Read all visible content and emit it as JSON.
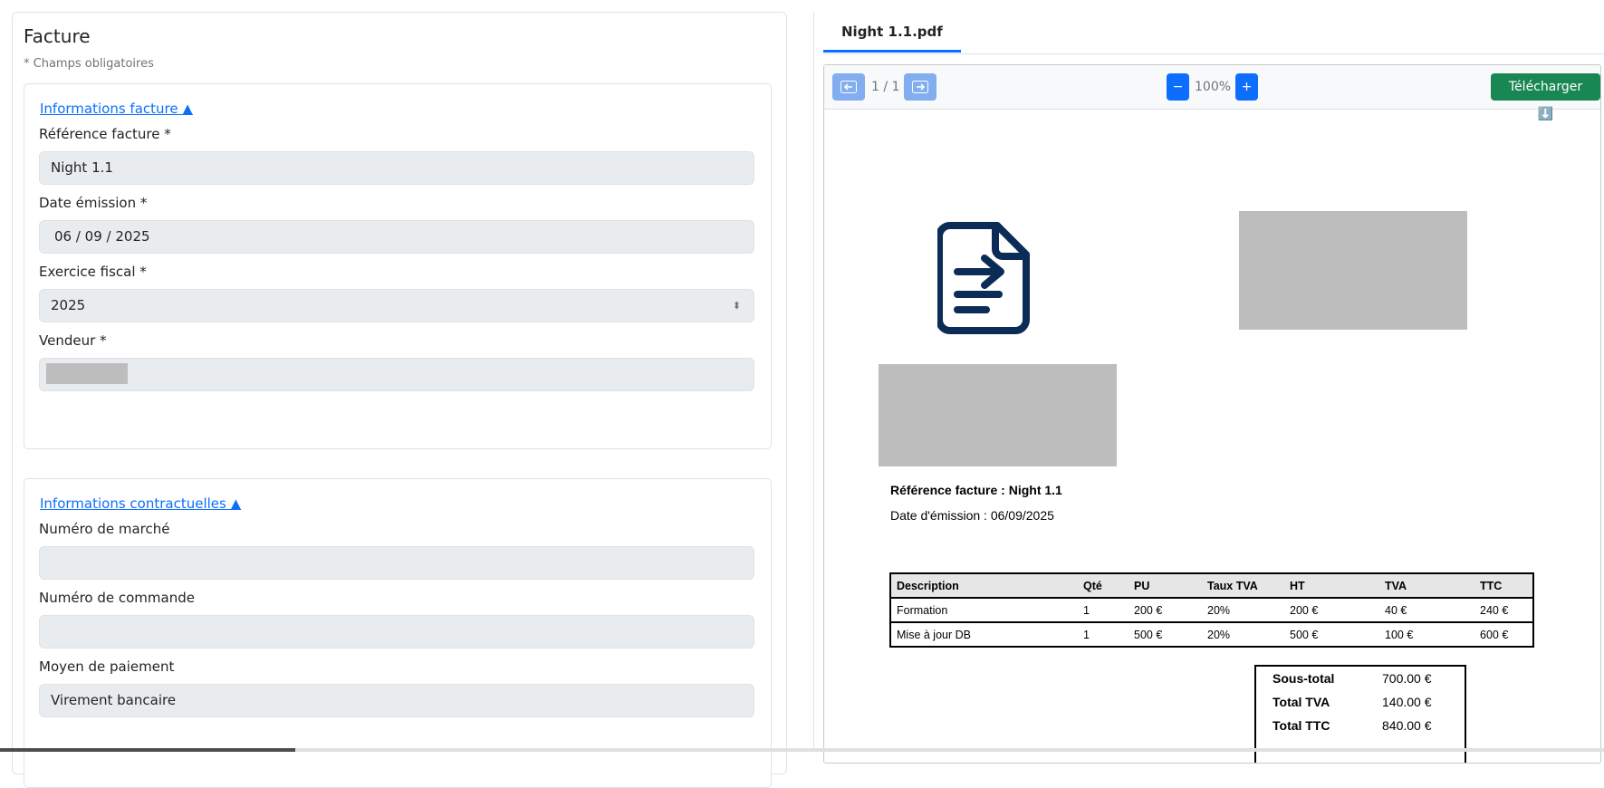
{
  "form": {
    "title": "Facture",
    "required_note": "* Champs obligatoires",
    "section_invoice": {
      "toggle": "Informations facture ▲",
      "reference_label": "Référence facture *",
      "reference_value": "Night 1.1",
      "date_label": "Date émission *",
      "date_value": "06 / 09 / 2025",
      "fiscal_label": "Exercice fiscal *",
      "fiscal_value": "2025",
      "seller_label": "Vendeur *"
    },
    "section_contract": {
      "toggle": "Informations contractuelles ▲",
      "market_label": "Numéro de marché",
      "market_value": "",
      "order_label": "Numéro de commande",
      "order_value": "",
      "payment_label": "Moyen de paiement",
      "payment_value": "Virement bancaire"
    }
  },
  "tab": {
    "label": "Night 1.1.pdf"
  },
  "viewer": {
    "prev_icon": "arrow-left-icon",
    "next_icon": "arrow-right-icon",
    "page_indicator": "1 / 1",
    "zoom_out": "−",
    "zoom_level": "100%",
    "zoom_in": "+",
    "download_label": "Télécharger ⬇️"
  },
  "document": {
    "logo_icon": "file-import-icon",
    "reference_line": "Référence facture : Night 1.1",
    "date_line": "Date d'émission : 06/09/2025",
    "table": {
      "headers": [
        "Description",
        "Qté",
        "PU",
        "Taux TVA",
        "HT",
        "TVA",
        "TTC"
      ],
      "rows": [
        [
          "Formation",
          "1",
          "200 €",
          "20%",
          "200 €",
          "40 €",
          "240 €"
        ],
        [
          "Mise à jour DB",
          "1",
          "500 €",
          "20%",
          "500 €",
          "100 €",
          "600 €"
        ]
      ]
    },
    "totals": {
      "subtotal_label": "Sous-total",
      "subtotal_value": "700.00 €",
      "vat_label": "Total TVA",
      "vat_value": "140.00 €",
      "ttc_label": "Total TTC",
      "ttc_value": "840.00 €"
    }
  },
  "colors": {
    "primary": "#0d6efd",
    "success": "#198754",
    "field_bg": "#e9ecef",
    "doc_icon": "#0b2c57"
  }
}
